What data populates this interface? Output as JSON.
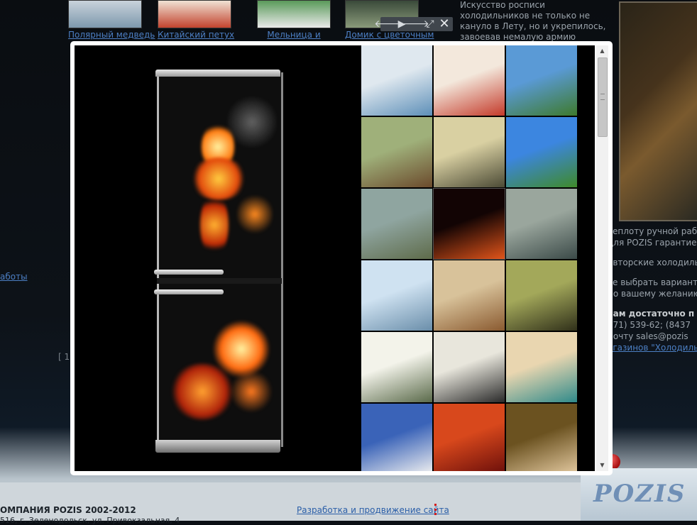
{
  "background_page": {
    "thumbnails": [
      {
        "label": "Полярный медведь"
      },
      {
        "label": "Китайский петух"
      },
      {
        "label": "Мельница и"
      },
      {
        "label": "Домик с цветочным"
      }
    ],
    "right_text": "Искусство росписи холодильников не только не кануло в Лету, но и укрепилось, завоевав немалую армию поклонников.",
    "right_lines": [
      "теплоту ручной раб",
      "для POZIS гарантие",
      "",
      "авторские холодиль",
      "",
      "те выбрать вариант з",
      "по вашему желанию",
      "",
      "вам достаточно п",
      "371) 539-62; (8437",
      "почту sales@pozis",
      "агазинов \"Холодиль"
    ],
    "left_link": "аботы",
    "left_bracket": "[ 1",
    "footer": {
      "copyright": "ОМПАНИЯ POZIS 2002-2012",
      "address": "516, г. Зеленодольск, ул. Привокзальная, 4",
      "dev_link": "Разработка и продвижение сайта"
    },
    "logo_text": "POZIS"
  },
  "lightbox": {
    "controls": [
      {
        "name": "prev-arrow-icon",
        "glyph": "🡐"
      },
      {
        "name": "play-icon",
        "glyph": "▶"
      },
      {
        "name": "next-arrow-icon",
        "glyph": "🡒"
      },
      {
        "name": "fullscreen-icon",
        "glyph": "⤢"
      },
      {
        "name": "close-icon",
        "glyph": "✕"
      }
    ],
    "gallery": [
      {
        "name": "polar-bear",
        "colors": [
          "#dfe8ef",
          "#5d8fb8"
        ]
      },
      {
        "name": "rooster",
        "colors": [
          "#f3e8dc",
          "#c43a2a"
        ]
      },
      {
        "name": "windmill",
        "colors": [
          "#5a9ad6",
          "#3e7a2c"
        ]
      },
      {
        "name": "cottage",
        "colors": [
          "#9fb07a",
          "#6b4a2c"
        ]
      },
      {
        "name": "sailing-ship",
        "colors": [
          "#d9d0a2",
          "#4b4a35"
        ]
      },
      {
        "name": "lighthouse",
        "colors": [
          "#3c86e0",
          "#3f8a2a"
        ]
      },
      {
        "name": "flower-vase",
        "colors": [
          "#8fa5a0",
          "#5e6b4a"
        ]
      },
      {
        "name": "fire-flower",
        "colors": [
          "#120404",
          "#e1541a"
        ]
      },
      {
        "name": "stormy-sea",
        "colors": [
          "#9aa69d",
          "#3b4a48"
        ]
      },
      {
        "name": "ice-ship",
        "colors": [
          "#cfe2f1",
          "#6a8eaa"
        ]
      },
      {
        "name": "ruins",
        "colors": [
          "#d8c29a",
          "#8a5a30"
        ]
      },
      {
        "name": "bamboo-green",
        "colors": [
          "#a3a85a",
          "#30301a"
        ]
      },
      {
        "name": "bamboo-light",
        "colors": [
          "#f3f3ea",
          "#5a6a4a"
        ]
      },
      {
        "name": "bamboo-ink",
        "colors": [
          "#e8e6dc",
          "#2a2a2a"
        ]
      },
      {
        "name": "leprechaun",
        "colors": [
          "#e9d6b0",
          "#2f8a8a"
        ]
      },
      {
        "name": "cartoon-diver",
        "colors": [
          "#3a63b8",
          "#f0f0f0"
        ]
      },
      {
        "name": "fire-bird",
        "colors": [
          "#d8481c",
          "#6a0e0a"
        ]
      },
      {
        "name": "girl-grapes",
        "colors": [
          "#6b5220",
          "#e3c9a0"
        ]
      }
    ],
    "selected_index": 7
  }
}
